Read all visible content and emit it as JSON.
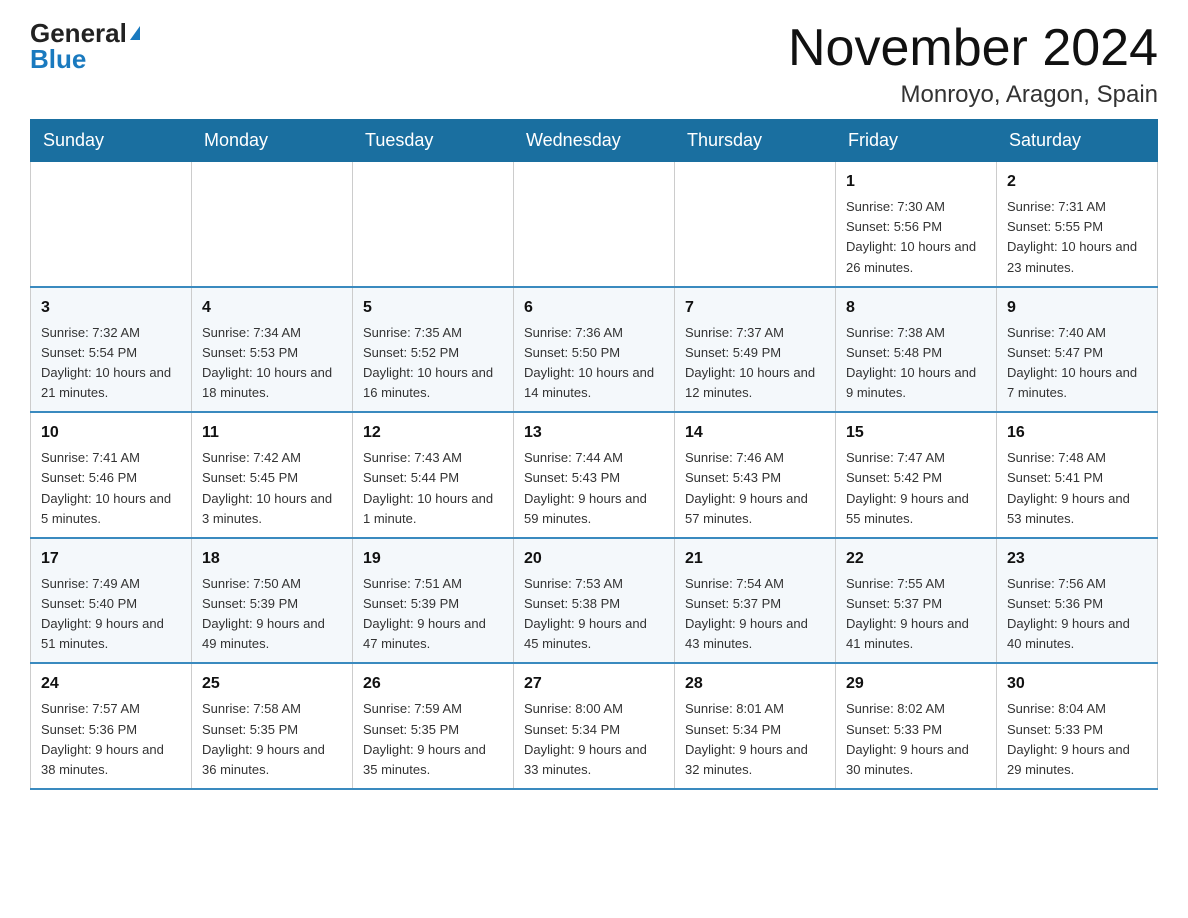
{
  "header": {
    "logo_general": "General",
    "logo_blue": "Blue",
    "month_title": "November 2024",
    "location": "Monroyo, Aragon, Spain"
  },
  "weekdays": [
    "Sunday",
    "Monday",
    "Tuesday",
    "Wednesday",
    "Thursday",
    "Friday",
    "Saturday"
  ],
  "weeks": [
    [
      {
        "day": "",
        "info": ""
      },
      {
        "day": "",
        "info": ""
      },
      {
        "day": "",
        "info": ""
      },
      {
        "day": "",
        "info": ""
      },
      {
        "day": "",
        "info": ""
      },
      {
        "day": "1",
        "info": "Sunrise: 7:30 AM\nSunset: 5:56 PM\nDaylight: 10 hours and 26 minutes."
      },
      {
        "day": "2",
        "info": "Sunrise: 7:31 AM\nSunset: 5:55 PM\nDaylight: 10 hours and 23 minutes."
      }
    ],
    [
      {
        "day": "3",
        "info": "Sunrise: 7:32 AM\nSunset: 5:54 PM\nDaylight: 10 hours and 21 minutes."
      },
      {
        "day": "4",
        "info": "Sunrise: 7:34 AM\nSunset: 5:53 PM\nDaylight: 10 hours and 18 minutes."
      },
      {
        "day": "5",
        "info": "Sunrise: 7:35 AM\nSunset: 5:52 PM\nDaylight: 10 hours and 16 minutes."
      },
      {
        "day": "6",
        "info": "Sunrise: 7:36 AM\nSunset: 5:50 PM\nDaylight: 10 hours and 14 minutes."
      },
      {
        "day": "7",
        "info": "Sunrise: 7:37 AM\nSunset: 5:49 PM\nDaylight: 10 hours and 12 minutes."
      },
      {
        "day": "8",
        "info": "Sunrise: 7:38 AM\nSunset: 5:48 PM\nDaylight: 10 hours and 9 minutes."
      },
      {
        "day": "9",
        "info": "Sunrise: 7:40 AM\nSunset: 5:47 PM\nDaylight: 10 hours and 7 minutes."
      }
    ],
    [
      {
        "day": "10",
        "info": "Sunrise: 7:41 AM\nSunset: 5:46 PM\nDaylight: 10 hours and 5 minutes."
      },
      {
        "day": "11",
        "info": "Sunrise: 7:42 AM\nSunset: 5:45 PM\nDaylight: 10 hours and 3 minutes."
      },
      {
        "day": "12",
        "info": "Sunrise: 7:43 AM\nSunset: 5:44 PM\nDaylight: 10 hours and 1 minute."
      },
      {
        "day": "13",
        "info": "Sunrise: 7:44 AM\nSunset: 5:43 PM\nDaylight: 9 hours and 59 minutes."
      },
      {
        "day": "14",
        "info": "Sunrise: 7:46 AM\nSunset: 5:43 PM\nDaylight: 9 hours and 57 minutes."
      },
      {
        "day": "15",
        "info": "Sunrise: 7:47 AM\nSunset: 5:42 PM\nDaylight: 9 hours and 55 minutes."
      },
      {
        "day": "16",
        "info": "Sunrise: 7:48 AM\nSunset: 5:41 PM\nDaylight: 9 hours and 53 minutes."
      }
    ],
    [
      {
        "day": "17",
        "info": "Sunrise: 7:49 AM\nSunset: 5:40 PM\nDaylight: 9 hours and 51 minutes."
      },
      {
        "day": "18",
        "info": "Sunrise: 7:50 AM\nSunset: 5:39 PM\nDaylight: 9 hours and 49 minutes."
      },
      {
        "day": "19",
        "info": "Sunrise: 7:51 AM\nSunset: 5:39 PM\nDaylight: 9 hours and 47 minutes."
      },
      {
        "day": "20",
        "info": "Sunrise: 7:53 AM\nSunset: 5:38 PM\nDaylight: 9 hours and 45 minutes."
      },
      {
        "day": "21",
        "info": "Sunrise: 7:54 AM\nSunset: 5:37 PM\nDaylight: 9 hours and 43 minutes."
      },
      {
        "day": "22",
        "info": "Sunrise: 7:55 AM\nSunset: 5:37 PM\nDaylight: 9 hours and 41 minutes."
      },
      {
        "day": "23",
        "info": "Sunrise: 7:56 AM\nSunset: 5:36 PM\nDaylight: 9 hours and 40 minutes."
      }
    ],
    [
      {
        "day": "24",
        "info": "Sunrise: 7:57 AM\nSunset: 5:36 PM\nDaylight: 9 hours and 38 minutes."
      },
      {
        "day": "25",
        "info": "Sunrise: 7:58 AM\nSunset: 5:35 PM\nDaylight: 9 hours and 36 minutes."
      },
      {
        "day": "26",
        "info": "Sunrise: 7:59 AM\nSunset: 5:35 PM\nDaylight: 9 hours and 35 minutes."
      },
      {
        "day": "27",
        "info": "Sunrise: 8:00 AM\nSunset: 5:34 PM\nDaylight: 9 hours and 33 minutes."
      },
      {
        "day": "28",
        "info": "Sunrise: 8:01 AM\nSunset: 5:34 PM\nDaylight: 9 hours and 32 minutes."
      },
      {
        "day": "29",
        "info": "Sunrise: 8:02 AM\nSunset: 5:33 PM\nDaylight: 9 hours and 30 minutes."
      },
      {
        "day": "30",
        "info": "Sunrise: 8:04 AM\nSunset: 5:33 PM\nDaylight: 9 hours and 29 minutes."
      }
    ]
  ]
}
